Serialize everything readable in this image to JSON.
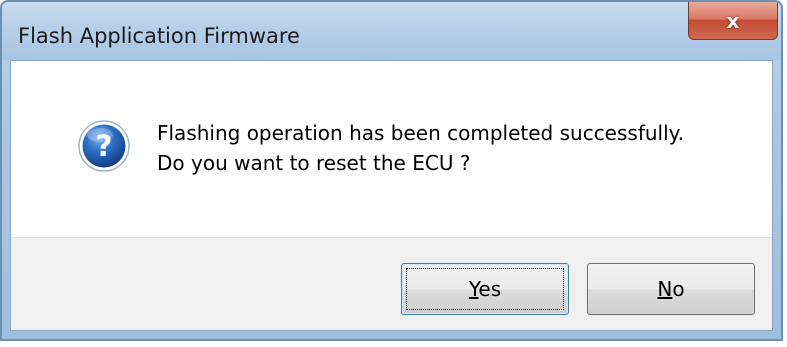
{
  "window": {
    "title": "Flash Application Firmware",
    "close_glyph": "x"
  },
  "message": {
    "icon": "question-icon",
    "line1": "Flashing operation has been completed successfully.",
    "line2": "Do you want to reset the ECU ?"
  },
  "buttons": {
    "yes": {
      "mnemonic": "Y",
      "rest": "es",
      "default": true
    },
    "no": {
      "mnemonic": "N",
      "rest": "o",
      "default": false
    }
  },
  "colors": {
    "icon_blue": "#1f5fb0",
    "close_red": "#c44b33",
    "button_panel": "#f0f0f0"
  }
}
